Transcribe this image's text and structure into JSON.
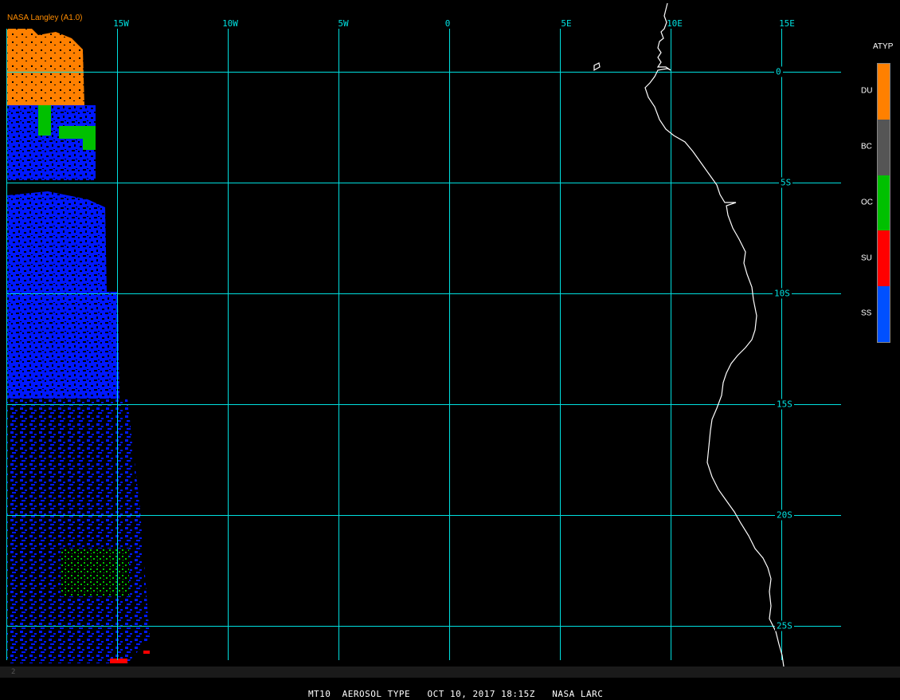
{
  "header": {
    "provider": "NASA Langley (A1.0)"
  },
  "map": {
    "longitude_labels": [
      "15W",
      "10W",
      "5W",
      "0",
      "5E",
      "10E",
      "15E"
    ],
    "latitude_labels": [
      "0",
      "5S",
      "10S",
      "15S",
      "20S",
      "25S"
    ],
    "grid_color": "#00e0e0",
    "coast_color": "#ffffff",
    "background_color": "#000000"
  },
  "legend": {
    "title": "ATYP",
    "items": [
      {
        "label": "DU",
        "color": "#ff8000"
      },
      {
        "label": "BC",
        "color": "#555555"
      },
      {
        "label": "OC",
        "color": "#00c000"
      },
      {
        "label": "SU",
        "color": "#ff0000"
      },
      {
        "label": "SS",
        "color": "#0050ff"
      }
    ]
  },
  "status": {
    "text": "MT10  AEROSOL TYPE   OCT 10, 2017 18:15Z   NASA LARC",
    "frame": "2"
  }
}
